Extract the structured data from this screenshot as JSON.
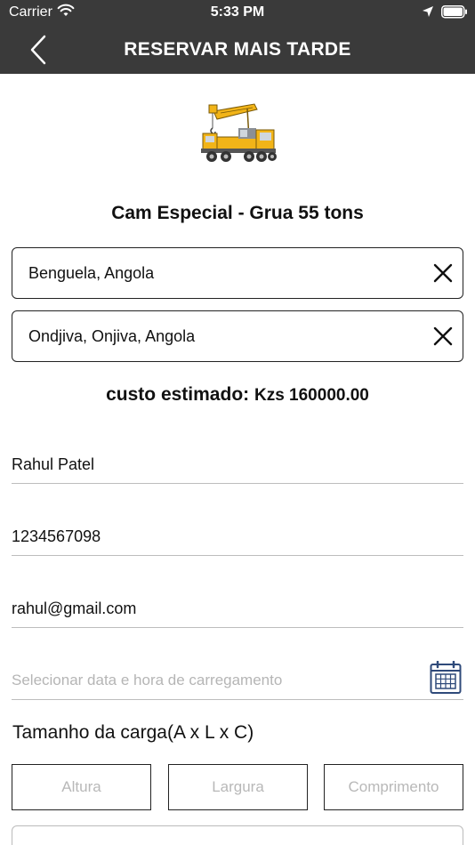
{
  "status_bar": {
    "carrier": "Carrier",
    "time": "5:33 PM",
    "wifi_icon": "wifi-icon",
    "location_icon": "location-arrow-icon",
    "battery_icon": "battery-icon"
  },
  "header": {
    "title": "RESERVAR MAIS TARDE",
    "back_icon": "chevron-left-icon",
    "background_color": "#3a3a3a"
  },
  "vehicle": {
    "image_icon": "crane-truck-icon",
    "name": "Cam Especial - Grua 55 tons"
  },
  "locations": {
    "pickup": "Benguela, Angola",
    "dropoff": "Ondjiva, Onjiva, Angola",
    "clear_icon": "close-icon"
  },
  "cost": {
    "label": "custo estimado:",
    "amount": "Kzs 160000.00"
  },
  "form": {
    "name": "Rahul Patel",
    "phone": "1234567098",
    "email": "rahul@gmail.com",
    "date_placeholder": "Selecionar data e hora de carregamento",
    "calendar_icon": "calendar-icon",
    "calendar_color": "#2f4a7a"
  },
  "cargo_size": {
    "label": "Tamanho da carga(A x L x C)",
    "height_placeholder": "Altura",
    "width_placeholder": "Largura",
    "length_placeholder": "Comprimento"
  }
}
